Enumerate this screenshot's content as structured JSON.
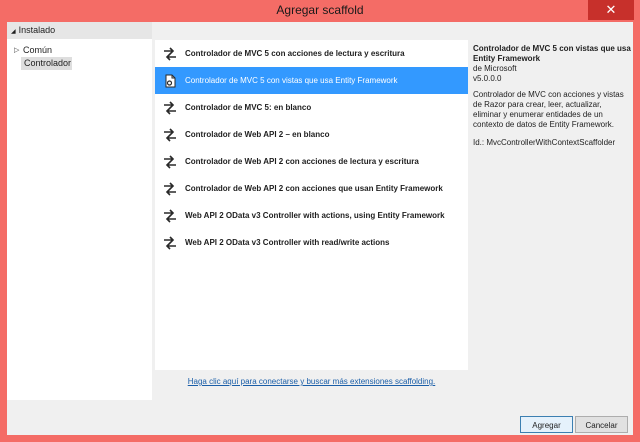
{
  "window": {
    "title": "Agregar scaffold",
    "close_label": "✕"
  },
  "tree": {
    "header": "Instalado",
    "items": [
      {
        "label": "Común"
      },
      {
        "label": "Controlador"
      }
    ]
  },
  "list": {
    "items": [
      {
        "label": "Controlador de MVC 5 con acciones de lectura y escritura"
      },
      {
        "label": "Controlador de MVC 5 con vistas que usa Entity Framework"
      },
      {
        "label": "Controlador de MVC 5: en blanco"
      },
      {
        "label": "Controlador de Web API 2 – en blanco"
      },
      {
        "label": "Controlador de Web API 2 con acciones de lectura y escritura"
      },
      {
        "label": "Controlador de Web API 2 con acciones que usan Entity Framework"
      },
      {
        "label": "Web API 2 OData v3 Controller with actions, using Entity Framework"
      },
      {
        "label": "Web API 2 OData v3 Controller with read/write actions"
      }
    ],
    "selected_index": 1
  },
  "details": {
    "title": "Controlador de MVC 5 con vistas que usa Entity Framework",
    "author": "de Microsoft",
    "version": "v5.0.0.0",
    "description": "Controlador de MVC con acciones y vistas de Razor para crear, leer, actualizar, eliminar y enumerar entidades de un contexto de datos de Entity Framework.",
    "id_line": "Id.: MvcControllerWithContextScaffolder"
  },
  "link_text": "Haga clic aquí para conectarse y buscar más extensiones scaffolding.",
  "buttons": {
    "add": "Agregar",
    "cancel": "Cancelar"
  },
  "colors": {
    "frame": "#f46c66",
    "selection": "#3399ff",
    "link": "#1a5ea8"
  },
  "icons": {
    "default_item": "arrows-icon",
    "selected_item": "document-gear-icon"
  }
}
